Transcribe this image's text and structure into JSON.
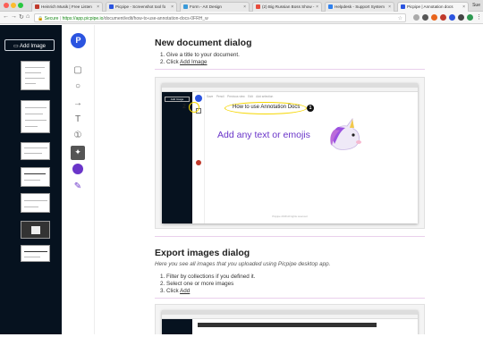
{
  "browser": {
    "tabs": [
      {
        "label": "Heinrich Musik | Free Listen",
        "icon_color": "#c0392b"
      },
      {
        "label": "Picpipe - Screenshot tool fo",
        "icon_color": "#2b54e0"
      },
      {
        "label": "Form - Art Design",
        "icon_color": "#3a9ad9"
      },
      {
        "label": "(2) Big Russian Boss Show -",
        "icon_color": "#e74c3c"
      },
      {
        "label": "Helpdesk - Support System",
        "icon_color": "#2f80ed"
      },
      {
        "label": "Picpipe | Annotation docs",
        "icon_color": "#2b54e0"
      }
    ],
    "profile": "Sue",
    "address": {
      "secure_label": "Secure",
      "separator": "|",
      "url_host": "https://app.picpipe.io",
      "url_path": "/document/edit/how-to-use-annotation-docs-0FRH_w"
    }
  },
  "sidebar": {
    "add_image_label": "Add Image",
    "add_image_icon": "image-icon"
  },
  "tools": {
    "logo_letter": "P",
    "items": [
      "rectangle-icon",
      "ellipse-icon",
      "arrow-icon",
      "text-icon",
      "counter-icon",
      "unicorn-sticker-icon",
      "color-swatch-icon",
      "pen-icon"
    ],
    "accent": "#6a35c9"
  },
  "doc": {
    "section1": {
      "title": "New document dialog",
      "step1": "1. Give a title to your document.",
      "step2_prefix": "2. Click ",
      "step2_link": "Add Image"
    },
    "shot1": {
      "callout_text": "How to use Annotation Docs",
      "badge1": "1",
      "badge2": "2",
      "main_text": "Add any text or emojis",
      "footer": "Picpipe 2018 All rights reserved",
      "inner_add_image": "Add Image",
      "inner_menu": [
        "Save",
        "Pencil",
        "Previous view",
        "Edit",
        "Add selection"
      ]
    },
    "section2": {
      "title": "Export images dialog",
      "intro": "Here you see all images that you uploaded using Picpipe desktop app.",
      "step1": "1. Filter by collections if you defined it.",
      "step2": "2. Select one or more images",
      "step3_prefix": "3. Click ",
      "step3_link": "Add"
    }
  },
  "colors": {
    "sidebar_bg": "#06121f",
    "brand_blue": "#2b54e0",
    "purple_text": "#6a35c9",
    "callout_yellow": "#f5d600"
  }
}
